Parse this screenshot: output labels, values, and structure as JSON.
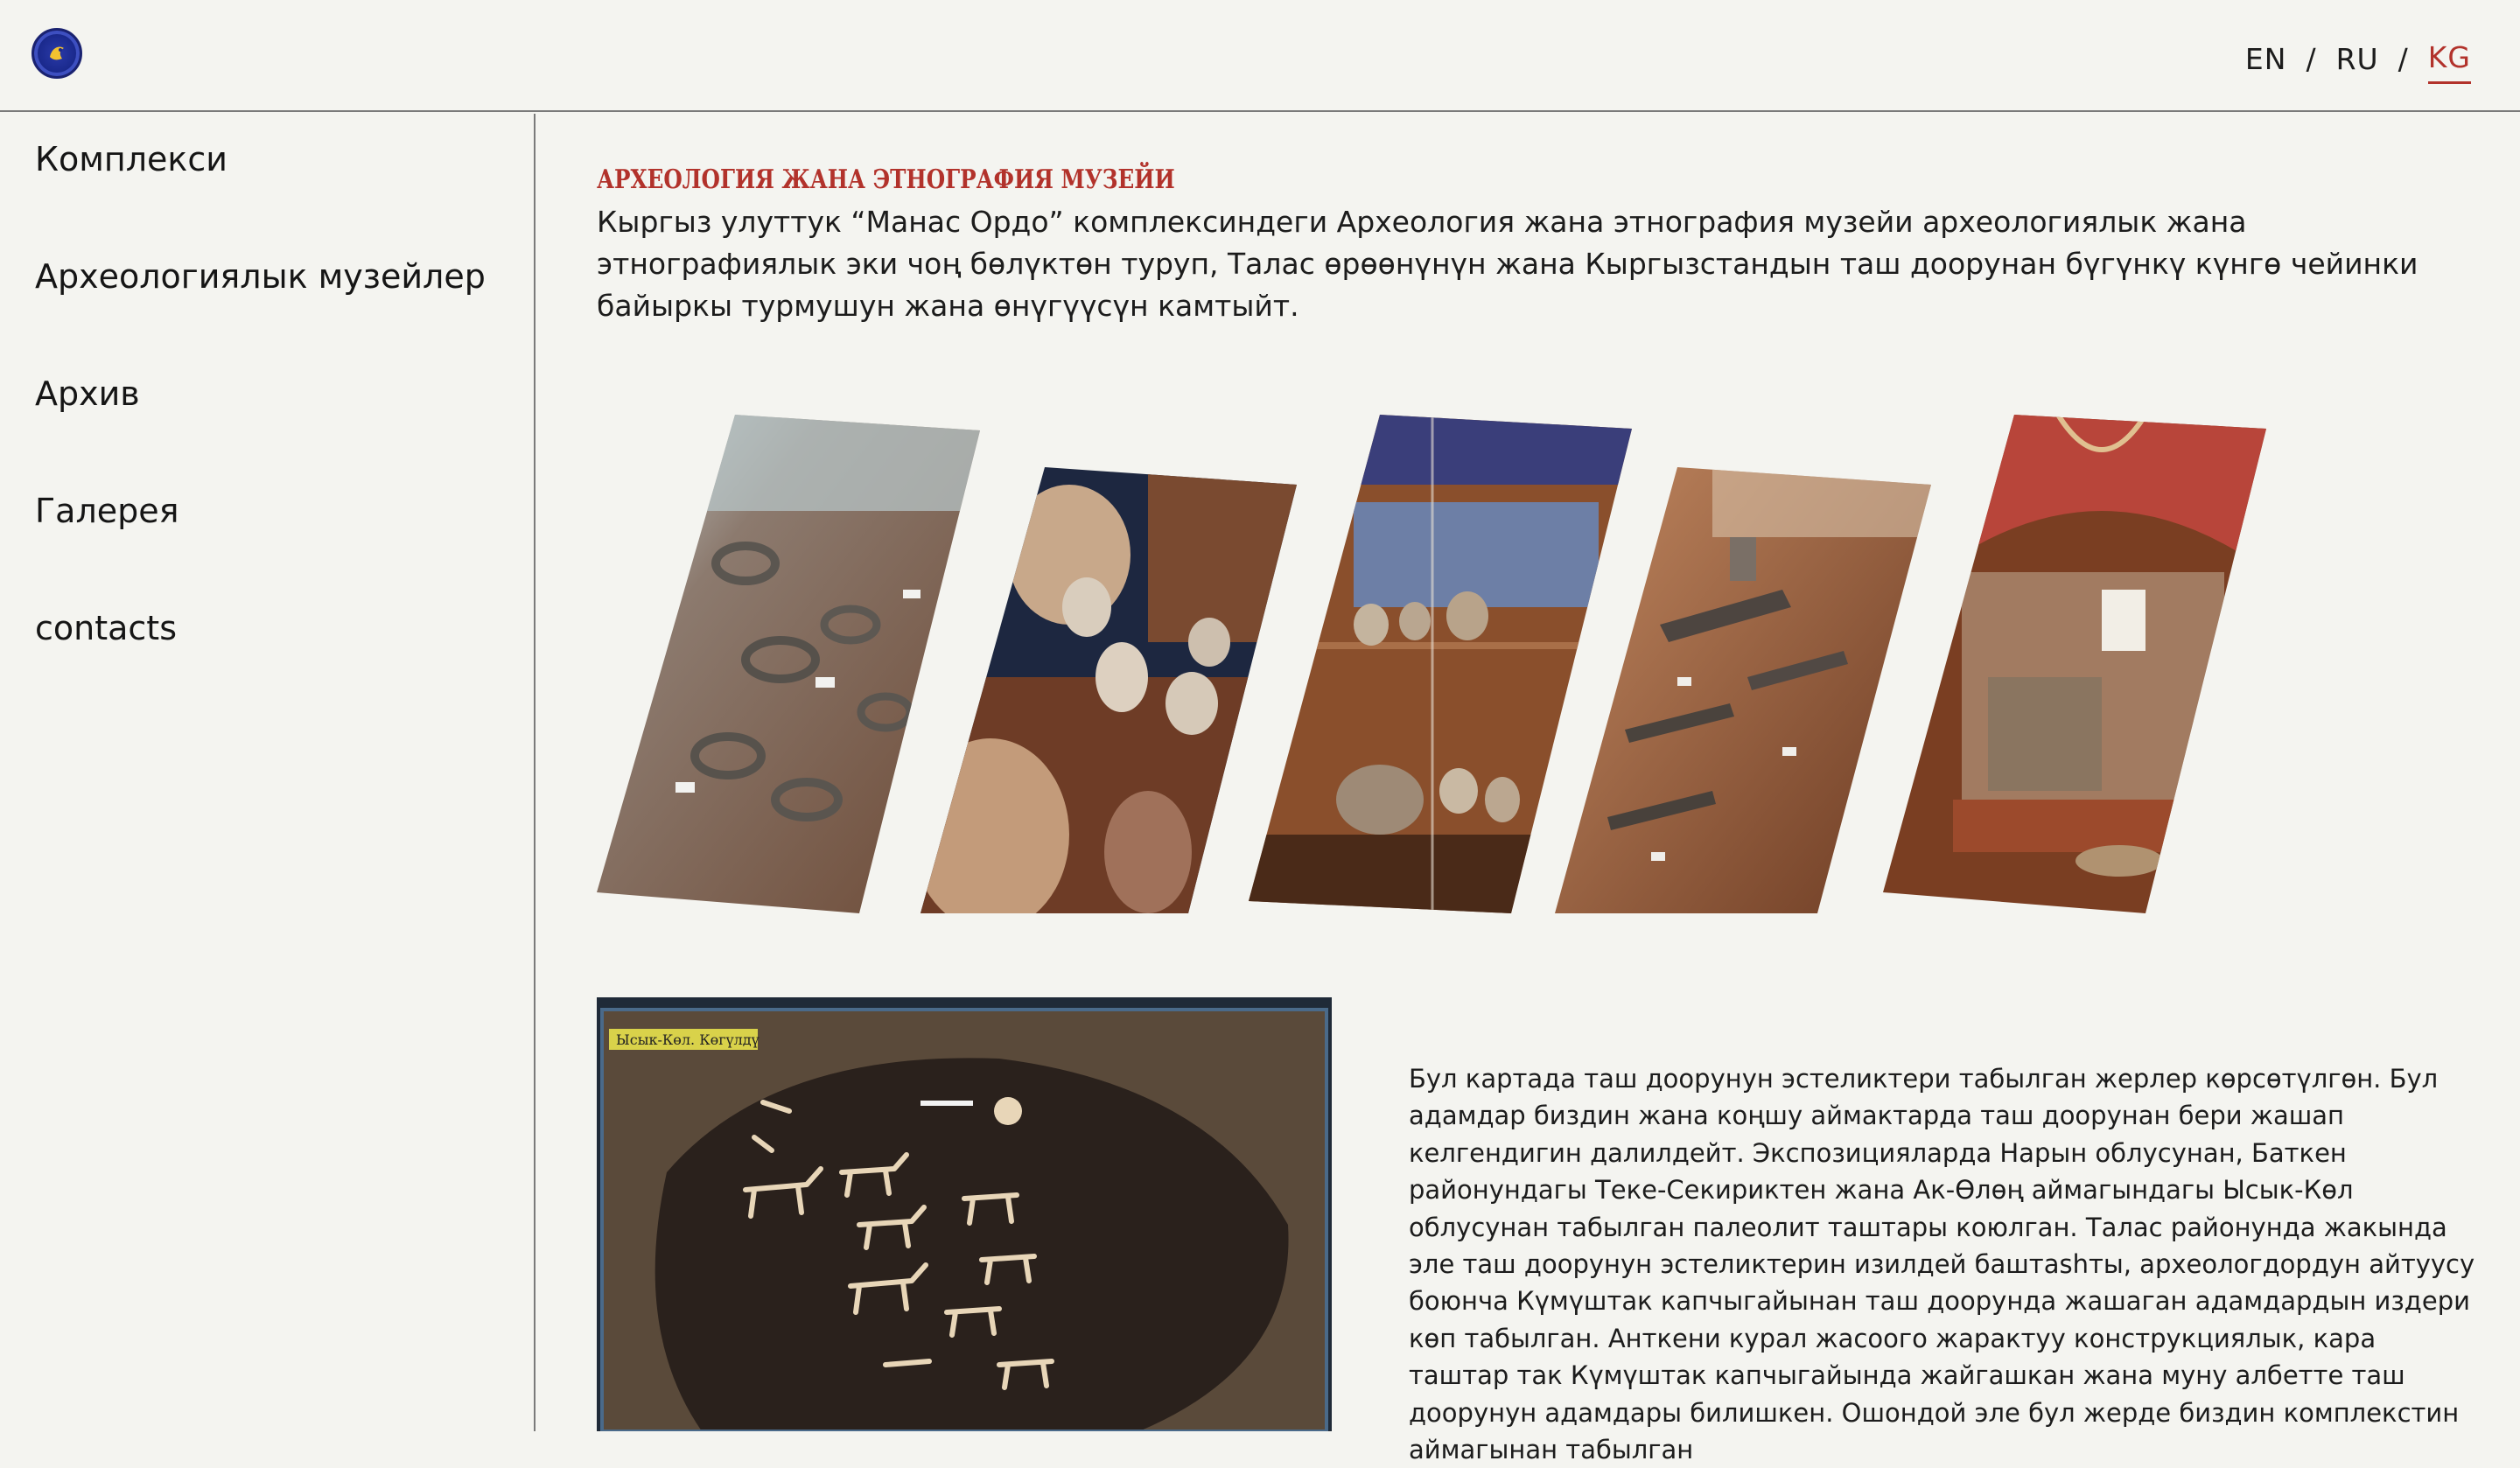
{
  "header": {
    "logo": "museum-logo",
    "languages": [
      {
        "label": "EN",
        "active": false
      },
      {
        "label": "RU",
        "active": false
      },
      {
        "label": "KG",
        "active": true
      }
    ],
    "separator": "/"
  },
  "sidebar": {
    "items": [
      {
        "label": "Комплекси"
      },
      {
        "label": "Археологиялык музейлер"
      },
      {
        "label": "Архив"
      },
      {
        "label": "Галерея"
      },
      {
        "label": "contacts"
      }
    ]
  },
  "main": {
    "section_title": "Археология жана этнография музейи",
    "intro": "Кыргыз улуттук “Манас Ордо” комплексиндеги Археология жана этнография музейи археологиялык жана этнографиялык эки чоң бөлүктөн туруп, Талас өрөөнүнүн жана Кыргызстандын таш доорунан бүгүнкү күнгө чейинки байыркы турмушун жана өнүгүүсүн камтыйт.",
    "gallery": [
      {
        "name": "horseshoes-display"
      },
      {
        "name": "clay-pottery-display"
      },
      {
        "name": "museum-showcase"
      },
      {
        "name": "tools-display"
      },
      {
        "name": "yurt-interior-display"
      }
    ],
    "map_image_caption": "Ысык-Көл. Көгүлдү",
    "body_text": "Бул картада таш доорунун эстеликтери табылган жерлер көрсөтүлгөн. Бул адамдар биздин жана коңшу аймактарда таш доорунан бери жашап келгендигин далилдейт. Экспозицияларда Нарын облусунан, Баткен районундагы Теке-Секириктен жана Ак-Өлөң аймагындагы Ысык-Көл облусунан табылган палеолит таштары коюлган. Талас районунда жакында эле таш доорунун эстеликтерин изилдей баштashты, археологдордун айтуусу боюнча Күмүштак капчыгайынан таш доорунда жашаган адамдардын издери көп табылган. Анткени курал жасоого жарактуу конструкциялык, кара таштар так Күмүштак капчыгайында жайгашкан жана муну албетте таш доорунун адамдары билишкен. Ошондой эле бул жерде биздин комплекстин аймагынан табылган"
  }
}
